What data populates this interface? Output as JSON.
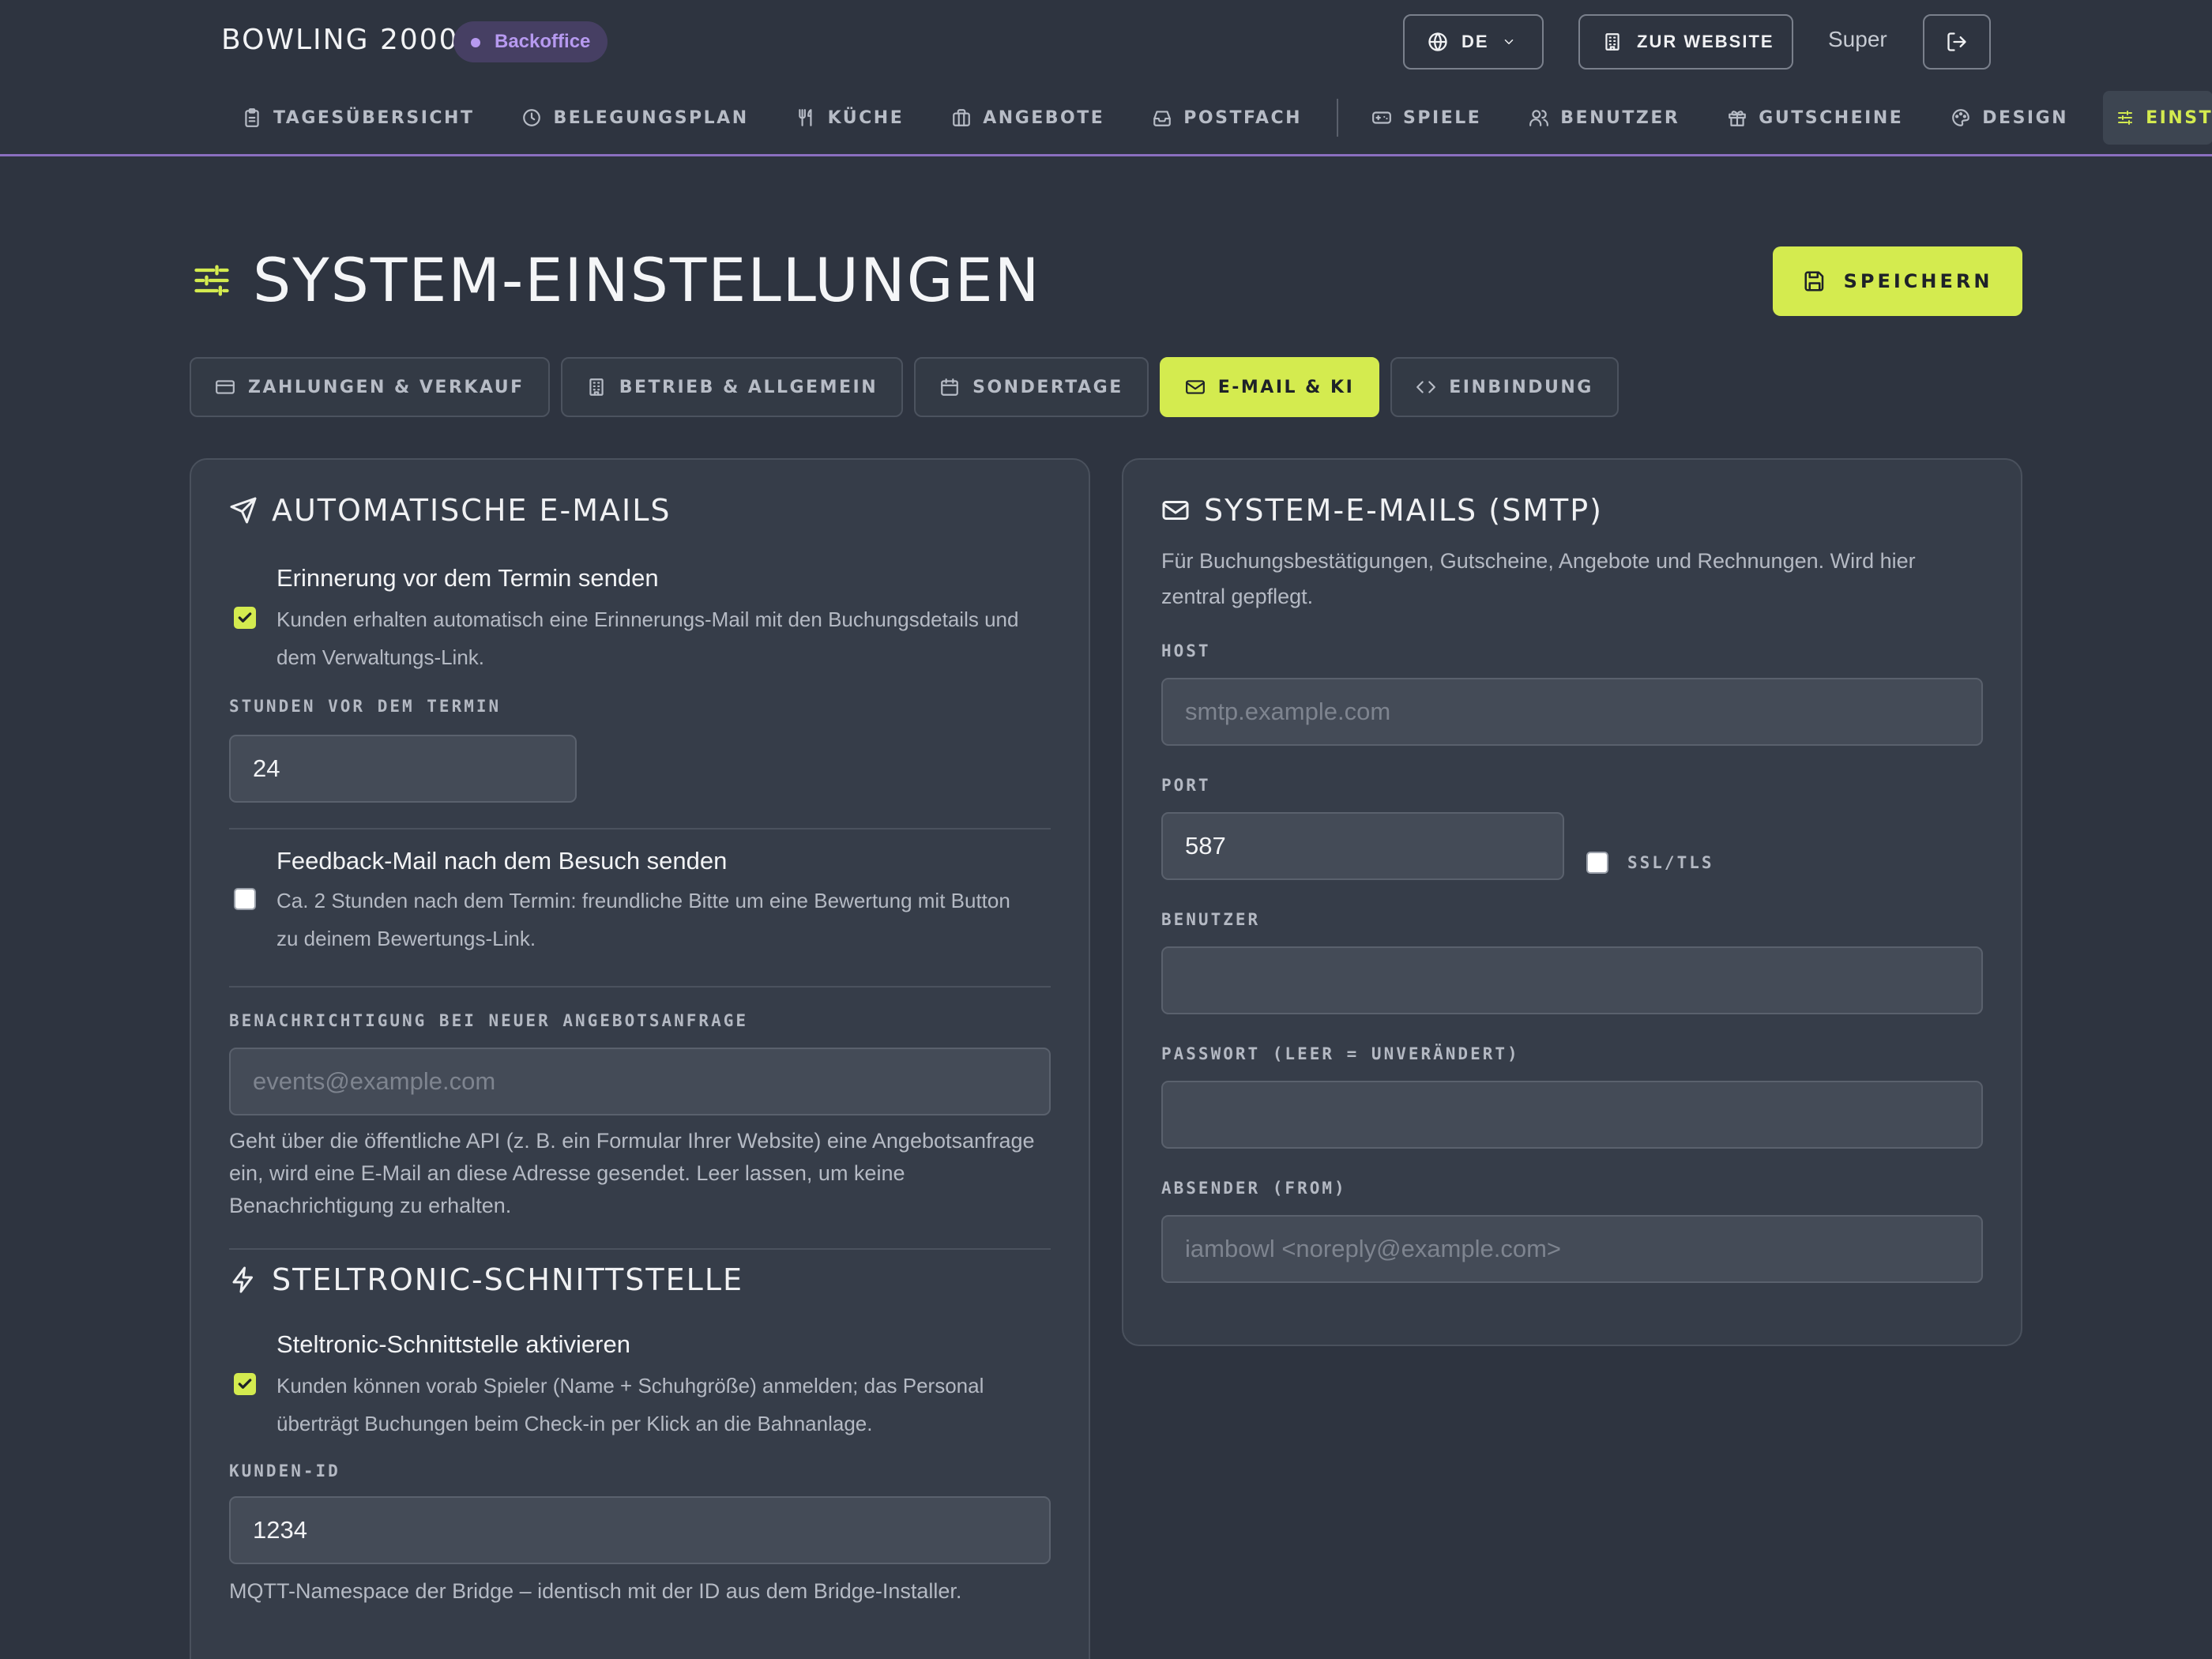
{
  "header": {
    "brand": "BOWLING 2000",
    "badge": "Backoffice",
    "language": "DE",
    "website_button": "ZUR WEBSITE",
    "user_name": "Super"
  },
  "nav": {
    "items": [
      {
        "label": "TAGESÜBERSICHT",
        "icon": "clipboard-icon"
      },
      {
        "label": "BELEGUNGSPLAN",
        "icon": "clock-icon"
      },
      {
        "label": "KÜCHE",
        "icon": "utensils-icon"
      },
      {
        "label": "ANGEBOTE",
        "icon": "briefcase-icon"
      },
      {
        "label": "POSTFACH",
        "icon": "inbox-icon"
      },
      {
        "label": "SPIELE",
        "icon": "gamepad-icon"
      },
      {
        "label": "BENUTZER",
        "icon": "users-icon"
      },
      {
        "label": "GUTSCHEINE",
        "icon": "gift-icon"
      },
      {
        "label": "DESIGN",
        "icon": "palette-icon"
      },
      {
        "label": "EINST",
        "icon": "sliders-icon"
      }
    ]
  },
  "page": {
    "title": "SYSTEM-EINSTELLUNGEN",
    "save_label": "SPEICHERN"
  },
  "tabs": [
    {
      "label": "ZAHLUNGEN & VERKAUF",
      "icon": "credit-card-icon"
    },
    {
      "label": "BETRIEB & ALLGEMEIN",
      "icon": "building-icon"
    },
    {
      "label": "SONDERTAGE",
      "icon": "calendar-icon"
    },
    {
      "label": "E-MAIL & KI",
      "icon": "mail-icon"
    },
    {
      "label": "EINBINDUNG",
      "icon": "code-icon"
    }
  ],
  "auto_emails": {
    "title": "AUTOMATISCHE E-MAILS",
    "reminder": {
      "checked": true,
      "title": "Erinnerung vor dem Termin senden",
      "desc_line1": "Kunden erhalten automatisch eine Erinnerungs-Mail mit den Buchungsdetails und",
      "desc_line2": "dem Verwaltungs-Link."
    },
    "hours_label": "STUNDEN VOR DEM TERMIN",
    "hours_value": "24",
    "feedback": {
      "checked": false,
      "title": "Feedback-Mail nach dem Besuch senden",
      "desc_line1": "Ca. 2 Stunden nach dem Termin: freundliche Bitte um eine Bewertung mit Button",
      "desc_line2": "zu deinem Bewertungs-Link."
    },
    "notify_label": "BENACHRICHTIGUNG BEI NEUER ANGEBOTSANFRAGE",
    "notify_placeholder": "events@example.com",
    "notify_help_line1": "Geht über die öffentliche API (z. B. ein Formular Ihrer Website) eine Angebotsanfrage",
    "notify_help_line2": "ein, wird eine E-Mail an diese Adresse gesendet. Leer lassen, um keine",
    "notify_help_line3": "Benachrichtigung zu erhalten."
  },
  "steltronic": {
    "title": "STELTRONIC-SCHNITTSTELLE",
    "enable": {
      "checked": true,
      "title": "Steltronic-Schnittstelle aktivieren",
      "desc_line1": "Kunden können vorab Spieler (Name + Schuhgröße) anmelden; das Personal",
      "desc_line2": "überträgt Buchungen beim Check-in per Klick an die Bahnanlage."
    },
    "customer_id_label": "KUNDEN-ID",
    "customer_id_value": "1234",
    "customer_id_help": "MQTT-Namespace der Bridge – identisch mit der ID aus dem Bridge-Installer."
  },
  "smtp": {
    "title": "SYSTEM-E-MAILS (SMTP)",
    "desc_line1": "Für Buchungsbestätigungen, Gutscheine, Angebote und Rechnungen. Wird hier",
    "desc_line2": "zentral gepflegt.",
    "host_label": "HOST",
    "host_placeholder": "smtp.example.com",
    "port_label": "PORT",
    "port_value": "587",
    "ssl_label": "SSL/TLS",
    "ssl_checked": false,
    "user_label": "BENUTZER",
    "user_value": "",
    "password_label": "PASSWORT (LEER = UNVERÄNDERT)",
    "password_value": "",
    "from_label": "ABSENDER (FROM)",
    "from_placeholder": "iambowl <noreply@example.com>"
  },
  "colors": {
    "accent": "#d4eb4f",
    "brand_purple": "#b79af0",
    "background": "#2e3440",
    "card": "#363d49"
  }
}
